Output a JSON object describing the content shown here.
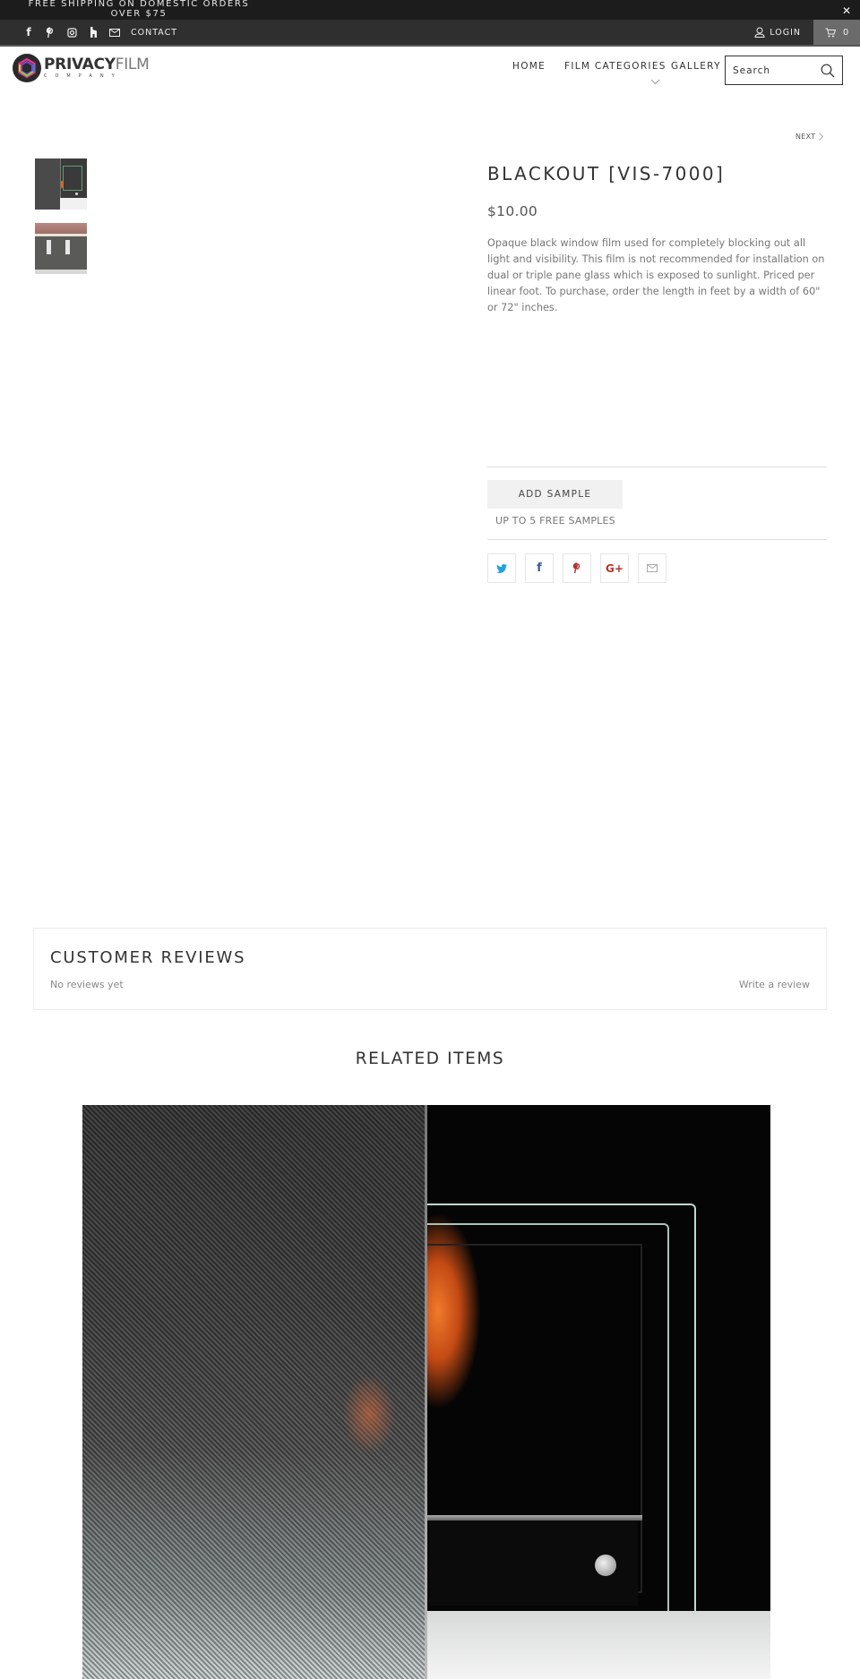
{
  "announcement": {
    "text": "FREE SHIPPING ON DOMESTIC ORDERS OVER $75",
    "close_icon": "close-icon"
  },
  "topbar": {
    "social_icons": [
      "facebook-icon",
      "pinterest-icon",
      "instagram-icon",
      "houzz-icon",
      "mail-icon"
    ],
    "contact_label": "CONTACT",
    "login_label": "LOGIN",
    "cart_count": "0"
  },
  "header": {
    "logo": {
      "brand_bold": "PRIVACY",
      "brand_light": "FILM",
      "sub": "COMPANY"
    },
    "nav": [
      {
        "label": "HOME"
      },
      {
        "label": "FILM CATEGORIES",
        "has_dropdown": true
      },
      {
        "label": "GALLERY"
      }
    ],
    "search": {
      "placeholder": "Search",
      "value": ""
    }
  },
  "product": {
    "next_label": "NEXT",
    "title": "BLACKOUT [VIS-7000]",
    "price": "$10.00",
    "description": "Opaque black window film used for completely blocking out all light and visibility. This film is not recommended for installation on dual or triple pane glass which is exposed to sunlight. Priced per linear foot. To purchase, order the length in feet by a width of 60\" or 72\" inches.",
    "thumbnails": [
      "product-thumbnail-fireplace",
      "product-thumbnail-building"
    ],
    "add_sample_label": "ADD SAMPLE",
    "samples_note": "UP TO 5 FREE SAMPLES",
    "share": [
      {
        "name": "twitter",
        "color": "#1fa3dd"
      },
      {
        "name": "facebook",
        "color": "#3b5998"
      },
      {
        "name": "pinterest",
        "color": "#b32d31"
      },
      {
        "name": "google-plus",
        "color": "#b8352d"
      },
      {
        "name": "email",
        "color": "#aaaaaa"
      }
    ]
  },
  "reviews": {
    "title": "CUSTOMER REVIEWS",
    "empty_text": "No reviews yet",
    "write_label": "Write a review"
  },
  "related": {
    "title": "RELATED ITEMS",
    "items": [
      {
        "image": "carbon-fiber-film-over-glass-fireplace"
      }
    ]
  }
}
